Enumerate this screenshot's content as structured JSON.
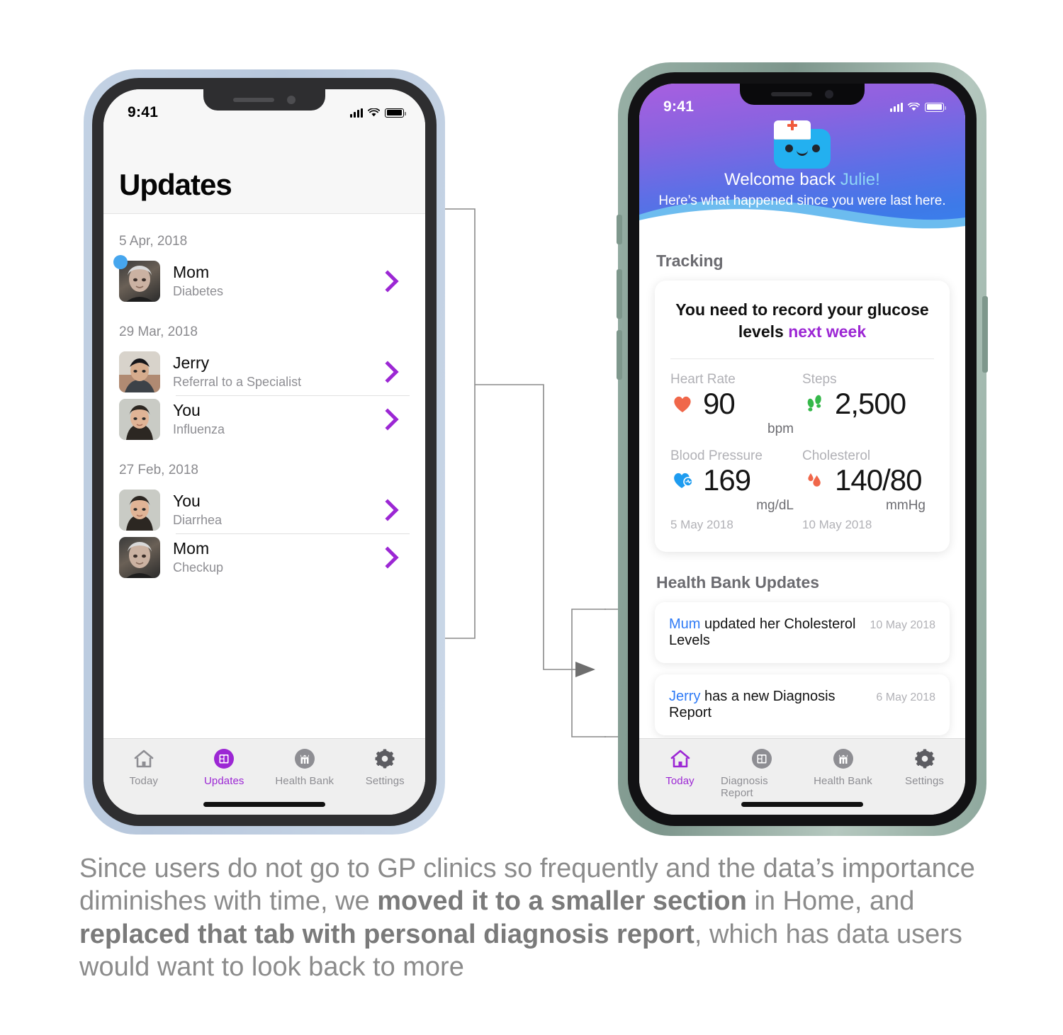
{
  "left_phone": {
    "status": {
      "time": "9:41"
    },
    "header_title": "Updates",
    "groups": [
      {
        "date": "5 Apr, 2018",
        "rows": [
          {
            "name": "Mom",
            "subtitle": "Diabetes",
            "unread": true,
            "avatar": "elderly-woman-photo"
          }
        ]
      },
      {
        "date": "29 Mar, 2018",
        "rows": [
          {
            "name": "Jerry",
            "subtitle": "Referral to a Specialist",
            "unread": false,
            "avatar": "young-man-photo"
          },
          {
            "name": "You",
            "subtitle": "Influenza",
            "unread": false,
            "avatar": "young-woman-photo"
          }
        ]
      },
      {
        "date": "27 Feb, 2018",
        "rows": [
          {
            "name": "You",
            "subtitle": "Diarrhea",
            "unread": false,
            "avatar": "young-woman-photo"
          },
          {
            "name": "Mom",
            "subtitle": "Checkup",
            "unread": false,
            "avatar": "elderly-woman-photo"
          }
        ]
      }
    ],
    "tabs": [
      {
        "label": "Today",
        "icon": "home-icon",
        "active": false
      },
      {
        "label": "Updates",
        "icon": "updates-icon",
        "active": true
      },
      {
        "label": "Health Bank",
        "icon": "health-bank-icon",
        "active": false
      },
      {
        "label": "Settings",
        "icon": "gear-icon",
        "active": false
      }
    ]
  },
  "right_phone": {
    "status": {
      "time": "9:41"
    },
    "hero": {
      "mascot": "nurse-robot-mascot",
      "welcome_prefix": "Welcome back ",
      "welcome_name": "Julie",
      "welcome_suffix": "!",
      "subtitle": "Here’s what happened since you were last here."
    },
    "tracking": {
      "section_title": "Tracking",
      "notice_prefix": "You need to record your glucose levels ",
      "notice_highlight": "next week",
      "metrics": [
        {
          "label": "Heart Rate",
          "icon": "heart-icon",
          "value": "90",
          "unit": "bpm",
          "date": ""
        },
        {
          "label": "Steps",
          "icon": "footsteps-icon",
          "value": "2,500",
          "unit": "",
          "date": ""
        },
        {
          "label": "Blood Pressure",
          "icon": "heart-pulse-icon",
          "value": "169",
          "unit": "mg/dL",
          "date": "5 May 2018"
        },
        {
          "label": "Cholesterol",
          "icon": "blood-drop-icon",
          "value": "140/80",
          "unit": "mmHg",
          "date": "10 May 2018"
        }
      ]
    },
    "health_bank": {
      "section_title": "Health Bank Updates",
      "items": [
        {
          "who": "Mum",
          "text": " updated her Cholesterol Levels",
          "date": "10 May 2018"
        },
        {
          "who": "Jerry",
          "text": " has a new Diagnosis Report",
          "date": "6 May 2018"
        }
      ]
    },
    "tabs": [
      {
        "label": "Today",
        "icon": "home-icon",
        "active": true
      },
      {
        "label": "Diagnosis Report",
        "icon": "updates-icon",
        "active": false
      },
      {
        "label": "Health Bank",
        "icon": "health-bank-icon",
        "active": false
      },
      {
        "label": "Settings",
        "icon": "gear-icon",
        "active": false
      }
    ]
  },
  "caption": {
    "p1": "Since users do not go to GP clinics so frequently and the data’s importance diminishes with time, we ",
    "b1": "moved it to a smaller section",
    "p2": " in Home, and ",
    "b2": "replaced that tab with personal diagnosis report",
    "p3": ", which has data users would want to look back to more"
  },
  "colors": {
    "accent_purple": "#9c27d4",
    "link_blue": "#2f7bf6",
    "badge_blue": "#46a6ee",
    "heart_red": "#f0674a",
    "steps_green": "#35b84a",
    "bp_blue": "#1e9cf0",
    "hero_gradient_start": "#a85fe0",
    "hero_gradient_end": "#3b82ef",
    "left_frame": "#bfcfe2",
    "right_frame": "#8da79c"
  }
}
